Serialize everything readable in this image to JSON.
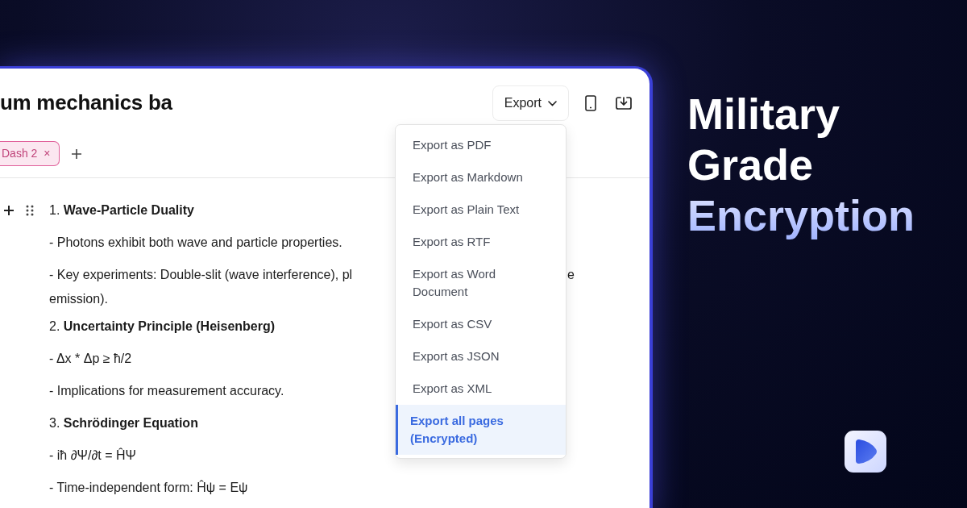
{
  "editor": {
    "title": "um mechanics ba",
    "tags": [
      {
        "label": "Dash 2",
        "close": "×"
      }
    ],
    "export_button": {
      "label": "Export"
    },
    "export_menu": [
      {
        "label": "Export as PDF",
        "selected": false
      },
      {
        "label": "Export as Markdown",
        "selected": false
      },
      {
        "label": "Export as Plain Text",
        "selected": false
      },
      {
        "label": "Export as RTF",
        "selected": false
      },
      {
        "label": "Export as Word Document",
        "selected": false
      },
      {
        "label": "Export as CSV",
        "selected": false
      },
      {
        "label": "Export as JSON",
        "selected": false
      },
      {
        "label": "Export as XML",
        "selected": false
      },
      {
        "label": "Export all pages (Encrypted)",
        "selected": true
      }
    ],
    "blocks": [
      {
        "kind": "line",
        "text": "1. **Wave-Particle Duality**",
        "handles": true
      },
      {
        "kind": "line",
        "text": "- Photons exhibit both wave and particle properties.",
        "handles": false
      },
      {
        "kind": "split",
        "text": "- Key experiments: Double-slit (wave interference), pl",
        "tail": "e",
        "next": "emission).",
        "handles": false
      },
      {
        "kind": "line",
        "text": "2. **Uncertainty Principle (Heisenberg)**",
        "handles": false
      },
      {
        "kind": "line",
        "text": "- Δx * Δp ≥ ħ/2",
        "handles": false
      },
      {
        "kind": "line",
        "text": "- Implications for measurement accuracy.",
        "handles": false
      },
      {
        "kind": "line",
        "text": "3. **Schrödinger Equation**",
        "handles": false
      },
      {
        "kind": "line",
        "text": "- iħ ∂Ψ/∂t = ĤΨ",
        "handles": false
      },
      {
        "kind": "line",
        "text": "- Time-independent form: Ĥψ = Eψ",
        "handles": false
      }
    ]
  },
  "promo": {
    "lines": [
      {
        "text": "Military",
        "highlight": false
      },
      {
        "text": "Grade",
        "highlight": false
      },
      {
        "text": "Encryption",
        "highlight": true
      }
    ]
  }
}
